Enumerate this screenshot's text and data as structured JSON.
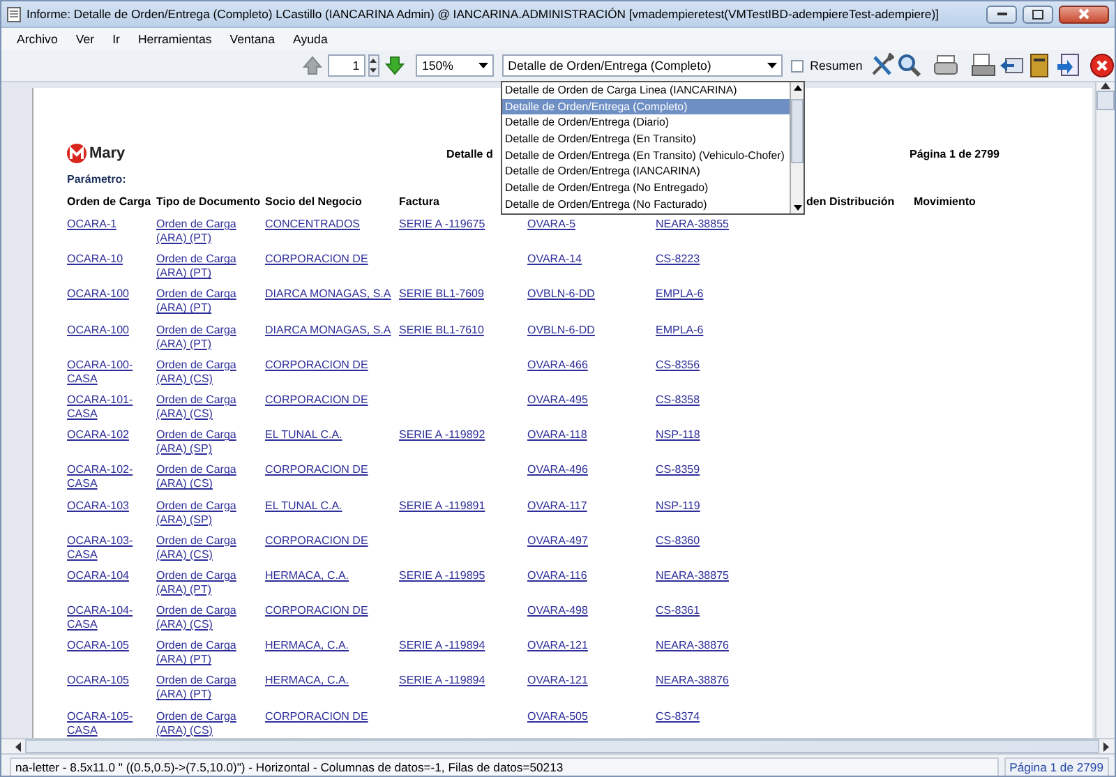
{
  "window": {
    "title": "Informe: Detalle de Orden/Entrega (Completo)  LCastillo (IANCARINA Admin) @ IANCARINA.ADMINISTRACIÓN [vmadempieretest(VMTestIBD-adempiereTest-adempiere)]"
  },
  "menu": [
    {
      "label": "Archivo"
    },
    {
      "label": "Ver"
    },
    {
      "label": "Ir"
    },
    {
      "label": "Herramientas"
    },
    {
      "label": "Ventana"
    },
    {
      "label": "Ayuda"
    }
  ],
  "toolbar": {
    "page": "1",
    "zoom": "150%",
    "report": "Detalle de Orden/Entrega (Completo)",
    "summary": {
      "label": "Resumen",
      "checked": false
    }
  },
  "report_list": [
    {
      "label": "Detalle de Orden de Carga Linea (IANCARINA)",
      "selected": false
    },
    {
      "label": "Detalle de Orden/Entrega (Completo)",
      "selected": true
    },
    {
      "label": "Detalle de Orden/Entrega (Diario)",
      "selected": false
    },
    {
      "label": "Detalle de Orden/Entrega (En Transito)",
      "selected": false
    },
    {
      "label": "Detalle de Orden/Entrega (En Transito) (Vehiculo-Chofer)",
      "selected": false
    },
    {
      "label": "Detalle de Orden/Entrega (IANCARINA)",
      "selected": false
    },
    {
      "label": "Detalle de Orden/Entrega (No Entregado)",
      "selected": false
    },
    {
      "label": "Detalle de Orden/Entrega (No Facturado)",
      "selected": false
    }
  ],
  "report": {
    "logo": "Mary",
    "title": "Detalle d",
    "page_label": "Página 1 de 2799",
    "parameter_label": "Parámetro:",
    "columns": [
      "Orden de Carga",
      "Tipo de Documento",
      "Socio del Negocio",
      "Factura"
    ],
    "columns_right": [
      "den Distribución",
      "Movimiento"
    ],
    "rows": [
      {
        "order": "OCARA-1",
        "doc_type": "Orden de Carga (ARA) (PT)",
        "partner": "CONCENTRADOS",
        "invoice": "SERIE A -119675",
        "column_5": "OVARA-5",
        "column_6": "NEARA-38855"
      },
      {
        "order": "OCARA-10",
        "doc_type": "Orden de Carga (ARA) (PT)",
        "partner": "CORPORACION DE",
        "column_5": "OVARA-14",
        "column_6": "CS-8223"
      },
      {
        "order": "OCARA-100",
        "doc_type": "Orden de Carga (ARA) (PT)",
        "partner": "DIARCA MONAGAS, S.A",
        "invoice": "SERIE BL1-7609",
        "column_5": "OVBLN-6-DD",
        "column_6": "EMPLA-6"
      },
      {
        "order": "OCARA-100",
        "doc_type": "Orden de Carga (ARA) (PT)",
        "partner": "DIARCA MONAGAS, S.A",
        "invoice": "SERIE BL1-7610",
        "column_5": "OVBLN-6-DD",
        "column_6": "EMPLA-6"
      },
      {
        "order": "OCARA-100-CASA",
        "doc_type": "Orden de Carga (ARA) (CS)",
        "partner": "CORPORACION DE",
        "column_5": "OVARA-466",
        "column_6": "CS-8356"
      },
      {
        "order": "OCARA-101-CASA",
        "doc_type": "Orden de Carga (ARA) (CS)",
        "partner": "CORPORACION DE",
        "column_5": "OVARA-495",
        "column_6": "CS-8358"
      },
      {
        "order": "OCARA-102",
        "doc_type": "Orden de Carga (ARA) (SP)",
        "partner": "EL TUNAL C.A.",
        "invoice": "SERIE A -119892",
        "column_5": "OVARA-118",
        "column_6": "NSP-118"
      },
      {
        "order": "OCARA-102-CASA",
        "doc_type": "Orden de Carga (ARA) (CS)",
        "partner": "CORPORACION DE",
        "column_5": "OVARA-496",
        "column_6": "CS-8359"
      },
      {
        "order": "OCARA-103",
        "doc_type": "Orden de Carga (ARA) (SP)",
        "partner": "EL TUNAL C.A.",
        "invoice": "SERIE A -119891",
        "column_5": "OVARA-117",
        "column_6": "NSP-119"
      },
      {
        "order": "OCARA-103-CASA",
        "doc_type": "Orden de Carga (ARA) (CS)",
        "partner": "CORPORACION DE",
        "column_5": "OVARA-497",
        "column_6": "CS-8360"
      },
      {
        "order": "OCARA-104",
        "doc_type": "Orden de Carga (ARA) (PT)",
        "partner": "HERMACA, C.A.",
        "invoice": "SERIE A -119895",
        "column_5": "OVARA-116",
        "column_6": "NEARA-38875"
      },
      {
        "order": "OCARA-104-CASA",
        "doc_type": "Orden de Carga (ARA) (CS)",
        "partner": "CORPORACION DE",
        "column_5": "OVARA-498",
        "column_6": "CS-8361"
      },
      {
        "order": "OCARA-105",
        "doc_type": "Orden de Carga (ARA) (PT)",
        "partner": "HERMACA, C.A.",
        "invoice": "SERIE A -119894",
        "column_5": "OVARA-121",
        "column_6": "NEARA-38876"
      },
      {
        "order": "OCARA-105",
        "doc_type": "Orden de Carga (ARA) (PT)",
        "partner": "HERMACA, C.A.",
        "invoice": "SERIE A -119894",
        "column_5": "OVARA-121",
        "column_6": "NEARA-38876"
      },
      {
        "order": "OCARA-105-CASA",
        "doc_type": "Orden de Carga (ARA) (CS)",
        "partner": "CORPORACION DE",
        "column_5": "OVARA-505",
        "column_6": "CS-8374"
      }
    ]
  },
  "status_bar": {
    "info": "na-letter - 8.5x11.0 \" ((0.5,0.5)->(7.5,10.0)\") - Horizontal - Columnas de datos=-1, Filas de datos=50213",
    "page": "Página 1 de 2799"
  }
}
